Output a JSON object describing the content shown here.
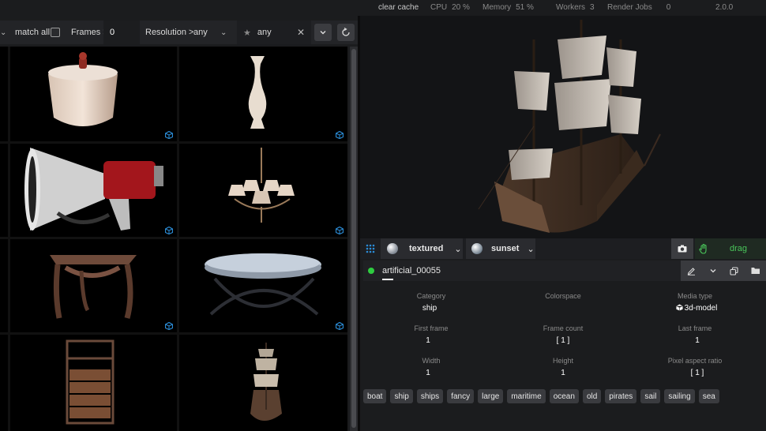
{
  "status_bar": {
    "clear_cache": "clear cache",
    "cpu_label": "CPU",
    "cpu_value": "20 %",
    "memory_label": "Memory",
    "memory_value": "51 %",
    "workers_label": "Workers",
    "workers_value": "3",
    "render_jobs_label": "Render Jobs",
    "render_jobs_value": "0",
    "version": "2.0.0"
  },
  "filter_bar": {
    "match_all_label": "match all",
    "match_all_checked": false,
    "frames_label": "Frames >",
    "frames_value": "0",
    "resolution_label": "Resolution >",
    "resolution_value": "any",
    "search_value": "any",
    "icons": {
      "star": "star-icon",
      "clear": "close-icon",
      "expand": "chevron-down-icon",
      "reset": "reset-icon"
    }
  },
  "render_toolbar": {
    "material_label": "textured",
    "environment_label": "sunset",
    "drag_label": "drag"
  },
  "asset": {
    "name": "artificial_00055",
    "status_color": "#2ecc40"
  },
  "metadata": {
    "category_label": "Category",
    "category_value": "ship",
    "colorspace_label": "Colorspace",
    "colorspace_value": "",
    "media_type_label": "Media type",
    "media_type_value": "3d-model",
    "first_frame_label": "First frame",
    "first_frame_value": "1",
    "frame_count_label": "Frame count",
    "frame_count_value": "[ 1 ]",
    "last_frame_label": "Last frame",
    "last_frame_value": "1",
    "width_label": "Width",
    "width_value": "1",
    "height_label": "Height",
    "height_value": "1",
    "pixel_aspect_label": "Pixel aspect ratio",
    "pixel_aspect_value": "[ 1 ]"
  },
  "tags": [
    "boat",
    "ship",
    "ships",
    "fancy",
    "large",
    "maritime",
    "ocean",
    "old",
    "pirates",
    "sail",
    "sailing",
    "sea"
  ],
  "grid_items": [
    "jar-thumbnail",
    "vase-thumbnail",
    "megaphone-thumbnail",
    "chandelier-thumbnail",
    "table-thumbnail",
    "round-table-thumbnail",
    "shelf-thumbnail",
    "ship-thumbnail"
  ],
  "colors": {
    "accent_green": "#49c55a",
    "cube_icon_blue": "#2b8cd6"
  }
}
